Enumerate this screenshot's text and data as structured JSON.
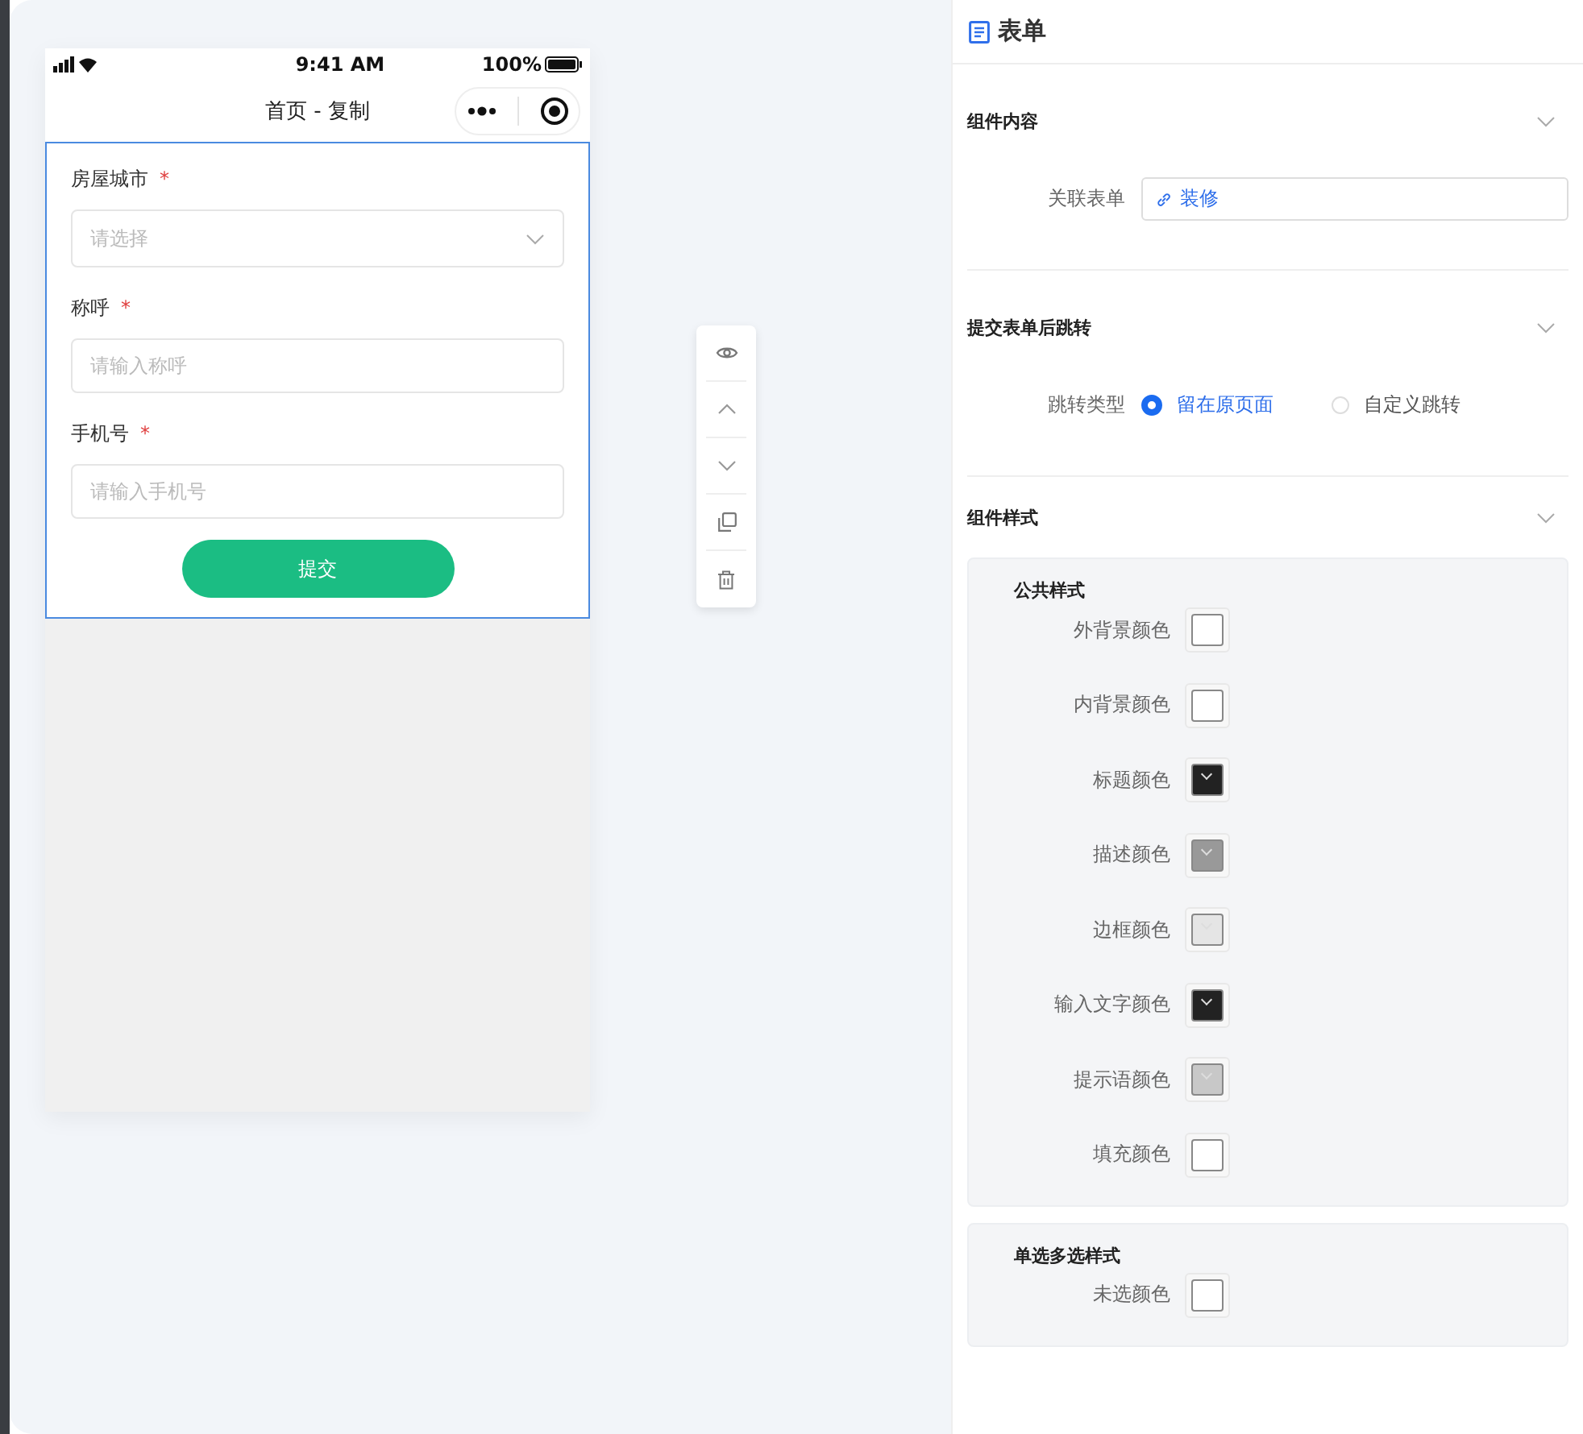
{
  "phone": {
    "status_bar": {
      "time": "9:41 AM",
      "battery": "100%"
    },
    "title": "首页 - 复制",
    "form": {
      "fields": [
        {
          "label": "房屋城市",
          "required_mark": "*",
          "kind": "select",
          "placeholder": "请选择"
        },
        {
          "label": "称呼",
          "required_mark": "*",
          "kind": "input",
          "placeholder": "请输入称呼"
        },
        {
          "label": "手机号",
          "required_mark": "*",
          "kind": "input",
          "placeholder": "请输入手机号"
        }
      ],
      "submit": "提交"
    }
  },
  "panel": {
    "title": "表单",
    "content_section": {
      "title": "组件内容",
      "linked_form": {
        "label": "关联表单",
        "value": "装修"
      }
    },
    "redirect_section": {
      "title": "提交表单后跳转",
      "label": "跳转类型",
      "options": [
        {
          "label": "留在原页面",
          "selected": true
        },
        {
          "label": "自定义跳转",
          "selected": false
        }
      ]
    },
    "style_section": {
      "title": "组件样式",
      "groups": [
        {
          "title": "公共样式",
          "colors": [
            {
              "label": "外背景颜色",
              "color": "#ffffff"
            },
            {
              "label": "内背景颜色",
              "color": "#ffffff"
            },
            {
              "label": "标题颜色",
              "color": "#222222"
            },
            {
              "label": "描述颜色",
              "color": "#999999"
            },
            {
              "label": "边框颜色",
              "color": "#e5e5e5"
            },
            {
              "label": "输入文字颜色",
              "color": "#222222"
            },
            {
              "label": "提示语颜色",
              "color": "#c8c8c8"
            },
            {
              "label": "填充颜色",
              "color": "#ffffff"
            }
          ]
        },
        {
          "title": "单选多选样式",
          "colors": [
            {
              "label": "未选颜色",
              "color": "#ffffff"
            }
          ]
        }
      ]
    }
  }
}
